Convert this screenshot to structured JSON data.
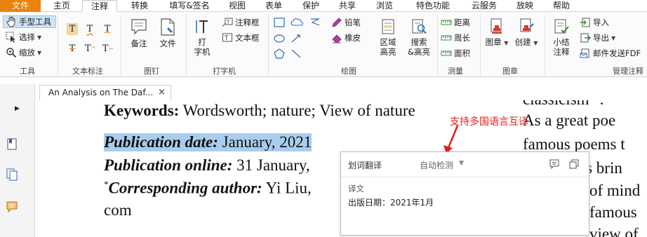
{
  "menu": {
    "file": "文件",
    "items": [
      "主页",
      "注释",
      "转换",
      "填写&签名",
      "视图",
      "表单",
      "保护",
      "共享",
      "浏览",
      "特色功能",
      "云服务",
      "放映",
      "帮助"
    ],
    "active": "注释"
  },
  "ribbon": {
    "tools": {
      "hand": "手型工具",
      "select": "选择",
      "zoom": "缩放",
      "label": "工具"
    },
    "text_markup": {
      "label": "文本标注"
    },
    "pin": {
      "note": "备注",
      "file": "文件",
      "label": "图钉"
    },
    "typewriter": {
      "type": "打\n字机",
      "type_line1": "打",
      "type_line2": "字机",
      "callout": "注释框",
      "textbox": "文本框",
      "label": "打字机"
    },
    "drawing": {
      "pencil": "铅笔",
      "eraser": "橡皮",
      "area_highlight_1": "区域",
      "area_highlight_2": "高亮",
      "search_highlight_1": "搜索",
      "search_highlight_2": "&高亮",
      "label": "绘图"
    },
    "measure": {
      "distance": "距离",
      "perimeter": "周长",
      "area": "面积",
      "label": "测量"
    },
    "stamp": {
      "stamp": "图章",
      "create": "创建",
      "label": "图章"
    },
    "manage": {
      "summary_1": "小结",
      "summary_2": "注释",
      "import": "导入",
      "export": "导出",
      "email_fdf": "邮件发送FDF",
      "label": "管理注释"
    }
  },
  "tab": {
    "title": "An Analysis on The Daf...",
    "close": "×"
  },
  "document": {
    "keywords_label": "Keywords:",
    "keywords_value": " Wordsworth; nature; View of nature",
    "pubdate_label": "Publication date:",
    "pubdate_value": " January, 2021",
    "pubonline_label": "Publication online:",
    "pubonline_value": " 31 January,",
    "author_mark": "*",
    "author_label": "Corresponding author:",
    "author_value": " Yi Liu,",
    "com": "com",
    "right_lines": [
      "classicism\" .",
      "As a great poe",
      "famous poems t",
      "poems brin",
      "of mind",
      "famous",
      "view of"
    ]
  },
  "annotation": "支持多国语言互译",
  "popup": {
    "title": "划词翻译",
    "detect": "自动检测",
    "result_label": "译文",
    "result_text": "出版日期：2021年1月"
  },
  "colors": {
    "file_menu": "#e8830f",
    "selection": "#a9cdee",
    "annotation": "#e0201c"
  }
}
